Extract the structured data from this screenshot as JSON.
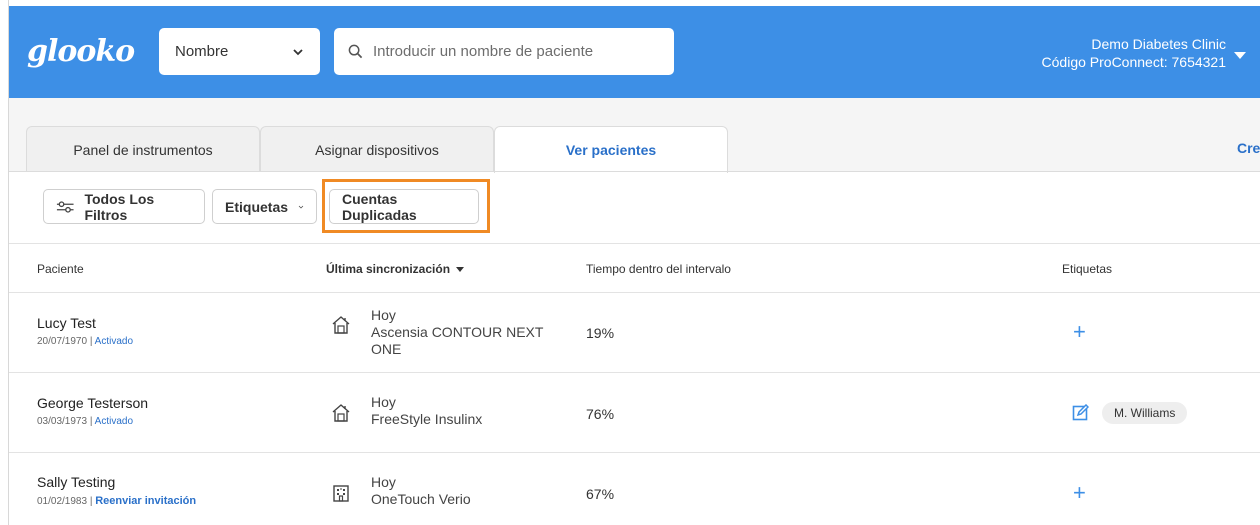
{
  "header": {
    "logo": "glooko",
    "search_type": "Nombre",
    "search_placeholder": "Introducir un nombre de paciente",
    "clinic_name": "Demo Diabetes Clinic",
    "clinic_code": "Código ProConnect: 7654321"
  },
  "tabs": [
    {
      "label": "Panel de instrumentos",
      "active": false
    },
    {
      "label": "Asignar dispositivos",
      "active": false
    },
    {
      "label": "Ver pacientes",
      "active": true
    }
  ],
  "tab_overflow": "Cre",
  "filters": {
    "all_filters": "Todos Los Filtros",
    "tags": "Etiquetas",
    "duplicates": "Cuentas Duplicadas"
  },
  "table": {
    "headers": {
      "patient": "Paciente",
      "last_sync": "Última sincronización",
      "time_in_range": "Tiempo dentro del intervalo",
      "tags": "Etiquetas"
    },
    "rows": [
      {
        "name": "Lucy Test",
        "dob": "20/07/1970",
        "status": "Activado",
        "sync_day": "Hoy",
        "device_line1": "Ascensia CONTOUR NEXT",
        "device_line2": "ONE",
        "device_icon": "home-icon",
        "tir": "19%",
        "tag": ""
      },
      {
        "name": "George Testerson",
        "dob": "03/03/1973",
        "status": "Activado",
        "sync_day": "Hoy",
        "device_line1": "FreeStyle Insulinx",
        "device_line2": "",
        "device_icon": "home-icon",
        "tir": "76%",
        "tag": "M. Williams"
      },
      {
        "name": "Sally Testing",
        "dob": "01/02/1983",
        "status": "Reenviar invitación",
        "sync_day": "Hoy",
        "device_line1": "OneTouch Verio",
        "device_line2": "",
        "device_icon": "building-icon",
        "tir": "67%",
        "tag": ""
      }
    ]
  },
  "colors": {
    "header_bg": "#3d8fe6",
    "link": "#2a70c9",
    "highlight": "#f08a24"
  }
}
